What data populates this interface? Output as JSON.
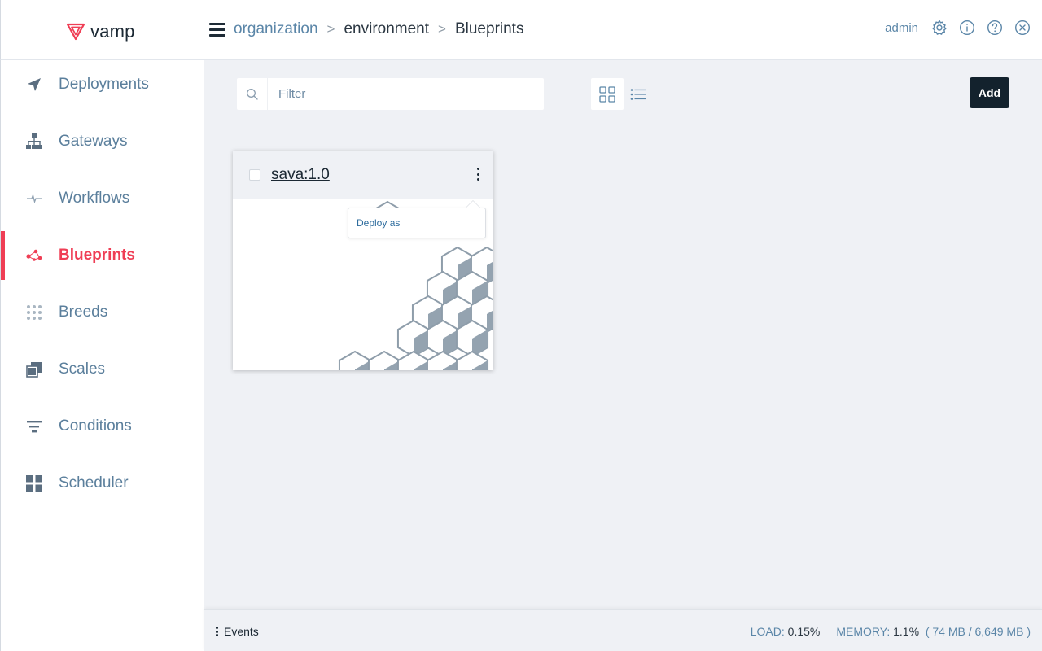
{
  "header": {
    "logo_text": "vamp",
    "breadcrumb": [
      {
        "label": "organization"
      },
      {
        "label": "environment"
      },
      {
        "label": "Blueprints"
      }
    ],
    "separator": ">",
    "user": "admin",
    "icons": [
      "gear-icon",
      "info-icon",
      "help-icon",
      "close-icon"
    ]
  },
  "sidebar": {
    "items": [
      {
        "label": "Deployments",
        "icon": "paper-plane-icon",
        "active": false
      },
      {
        "label": "Gateways",
        "icon": "network-icon",
        "active": false
      },
      {
        "label": "Workflows",
        "icon": "pulse-icon",
        "active": false
      },
      {
        "label": "Blueprints",
        "icon": "blueprint-icon",
        "active": true
      },
      {
        "label": "Breeds",
        "icon": "dots-grid-icon",
        "active": false
      },
      {
        "label": "Scales",
        "icon": "layers-icon",
        "active": false
      },
      {
        "label": "Conditions",
        "icon": "filter-icon",
        "active": false
      },
      {
        "label": "Scheduler",
        "icon": "grid-icon",
        "active": false
      }
    ]
  },
  "toolbar": {
    "filter_placeholder": "Filter",
    "add_label": "Add"
  },
  "card": {
    "title": "sava:1.0",
    "menu_items": [
      "Deploy as"
    ]
  },
  "footer": {
    "events_label": "Events",
    "load_label": "LOAD:",
    "load_value": "0.15%",
    "memory_label": "MEMORY:",
    "memory_value": "1.1%",
    "memory_detail": "( 74 MB / 6,649 MB )"
  },
  "colors": {
    "accent": "#ef3e55",
    "link": "#5b86a8",
    "dark": "#13222d",
    "background": "#eff1f5"
  }
}
